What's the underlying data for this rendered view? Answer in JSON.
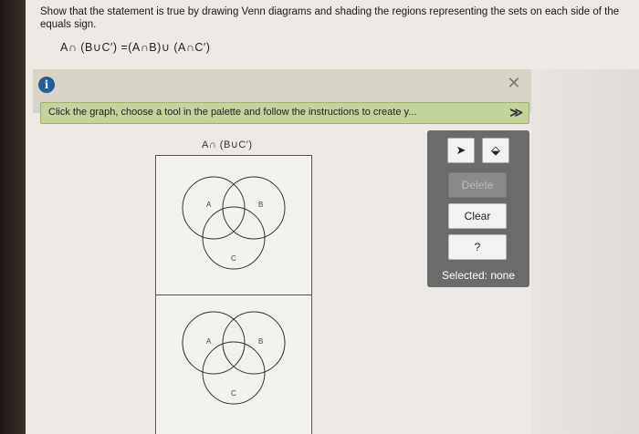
{
  "question": {
    "text": "Show that the statement is true by drawing Venn diagrams and shading the regions representing the sets on each side of the equals sign.",
    "equation": "A∩ (B∪C′) =(A∩B)∪ (A∩C′)"
  },
  "toolbar": {
    "instruction": "Click the graph, choose a tool in the palette and follow the instructions to create y...",
    "info_icon": "i",
    "close_icon": "✕",
    "expand_icon": "≫"
  },
  "graph": {
    "title": "A∩ (B∪C′)",
    "top_venn": {
      "labels": [
        "A",
        "B",
        "C"
      ]
    },
    "bottom_venn": {
      "labels": [
        "A",
        "B",
        "C"
      ]
    }
  },
  "palette": {
    "tools": [
      {
        "icon": "arrow-pointer-icon",
        "glyph": "➤"
      },
      {
        "icon": "paint-bucket-icon",
        "glyph": "⬙"
      }
    ],
    "delete_label": "Delete",
    "clear_label": "Clear",
    "help_label": "?",
    "selected_text": "Selected: none"
  },
  "colors": {
    "instruction_bar": "#c2d49a",
    "palette_bg": "#6b6b6b",
    "info_blue": "#1f5f9f"
  }
}
